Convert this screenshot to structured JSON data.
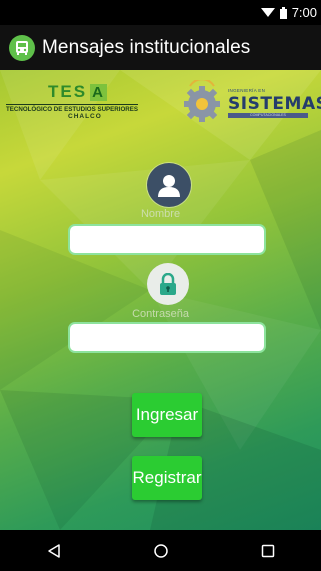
{
  "status_bar": {
    "time": "7:00"
  },
  "app_bar": {
    "title": "Mensajes institucionales"
  },
  "logos": {
    "tesha": {
      "title_text": "TES",
      "title_box": "A",
      "line1": "TECNOLÓGICO DE ESTUDIOS SUPERIORES",
      "line2": "CHALCO"
    },
    "sistemas": {
      "small": "INGENIERÍA EN",
      "word": "SISTEMAS",
      "sub": "COMPUTACIONALES"
    }
  },
  "form": {
    "user_label": "Nombre",
    "user_value": "",
    "password_label": "Contraseña",
    "password_value": ""
  },
  "buttons": {
    "login": "Ingresar",
    "register": "Registrar"
  },
  "colors": {
    "accent_green": "#2bcc32",
    "app_bar": "#111111",
    "input_border": "#8de39d"
  }
}
